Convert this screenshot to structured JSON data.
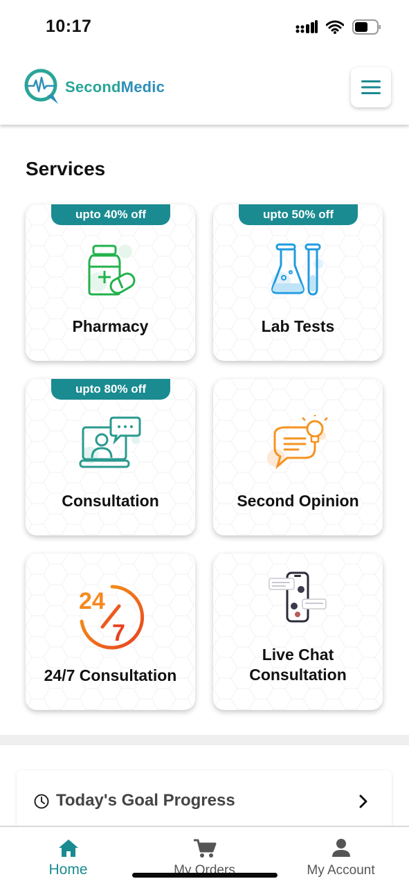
{
  "status_bar": {
    "time": "10:17"
  },
  "header": {
    "brand_part1": "Second",
    "brand_part2": "Medic"
  },
  "services": {
    "title": "Services",
    "cards": [
      {
        "label": "Pharmacy",
        "badge": "upto 40% off",
        "icon": "medicine-bottle-icon"
      },
      {
        "label": "Lab Tests",
        "badge": "upto 50% off",
        "icon": "lab-flask-icon"
      },
      {
        "label": "Consultation",
        "badge": "upto 80% off",
        "icon": "video-consult-icon"
      },
      {
        "label": "Second Opinion",
        "badge": "",
        "icon": "chat-bulb-icon"
      },
      {
        "label": "24/7 Consultation",
        "badge": "",
        "icon": "24-7-icon"
      },
      {
        "label_line1": "Live Chat",
        "label_line2": "Consultation",
        "badge": "",
        "icon": "phone-chat-icon"
      }
    ]
  },
  "goal": {
    "title": "Today's Goal Progress"
  },
  "bottom_nav": {
    "items": [
      {
        "label": "Home",
        "icon": "home-icon",
        "active": true
      },
      {
        "label": "My Orders",
        "icon": "cart-icon",
        "active": false
      },
      {
        "label": "My Account",
        "icon": "person-icon",
        "active": false
      }
    ]
  },
  "colors": {
    "accent": "#1a8b91",
    "brand_green": "#2aa598",
    "brand_blue": "#2e8fb8",
    "nav_active": "#1a8b91",
    "nav_inactive": "#555555"
  }
}
